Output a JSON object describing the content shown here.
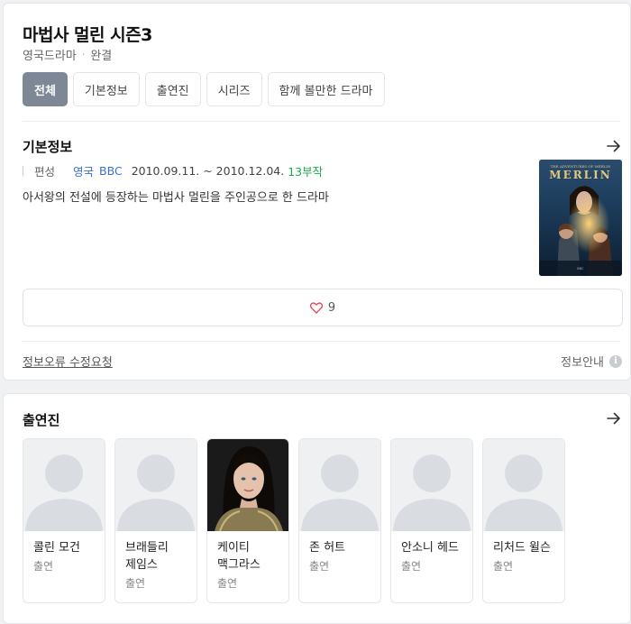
{
  "header": {
    "title": "마법사 멀린 시즌3",
    "genre": "영국드라마",
    "dot": "·",
    "status": "완결"
  },
  "tabs": [
    {
      "label": "전체",
      "active": true
    },
    {
      "label": "기본정보",
      "active": false
    },
    {
      "label": "출연진",
      "active": false
    },
    {
      "label": "시리즈",
      "active": false
    },
    {
      "label": "함께 볼만한 드라마",
      "active": false
    }
  ],
  "basic_info": {
    "section_title": "기본정보",
    "label": "편성",
    "country": "영국",
    "channel": "BBC",
    "dates": "2010.09.11. ~ 2010.12.04.",
    "episodes": "13부작",
    "description": "아서왕의 전설에 등장하는 마법사 멀린을 주인공으로 한 드라마",
    "poster_alt": "THE ADVENTURES OF MERLIN"
  },
  "like": {
    "count": "9",
    "icon": "heart-outline-icon"
  },
  "footer": {
    "report_link": "정보오류 수정요청",
    "info_guide": "정보안내",
    "info_icon_glyph": "i"
  },
  "cast": {
    "section_title": "출연진",
    "members": [
      {
        "name": "콜린 모건",
        "role": "출연",
        "has_photo": false
      },
      {
        "name": "브래들리 제임스",
        "role": "출연",
        "has_photo": false
      },
      {
        "name": "케이티 맥그라스",
        "role": "출연",
        "has_photo": true
      },
      {
        "name": "존 허트",
        "role": "출연",
        "has_photo": false
      },
      {
        "name": "안소니 헤드",
        "role": "출연",
        "has_photo": false
      },
      {
        "name": "리처드 윌슨",
        "role": "출연",
        "has_photo": false
      }
    ]
  },
  "colors": {
    "active_tab": "#7d8795",
    "link_blue": "#3a6fd0",
    "episodes_green": "#1fa84f",
    "heart_red": "#e0424f"
  }
}
